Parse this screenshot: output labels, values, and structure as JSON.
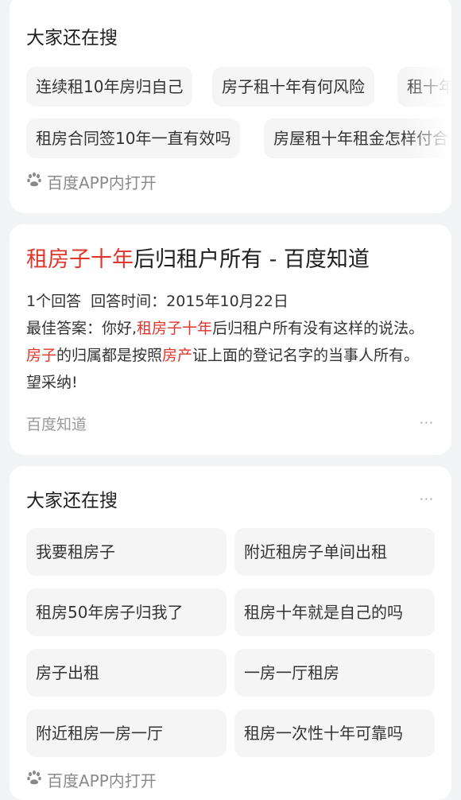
{
  "search_card_1": {
    "title": "大家还在搜",
    "chips_row1": [
      "连续租10年房归自己",
      "房子租十年有何风险",
      "租十年"
    ],
    "chips_row2": [
      "租房合同签10年一直有效吗",
      "房屋租十年租金怎样付合"
    ],
    "open_app": "百度APP内打开",
    "open_icon": "paw-icon"
  },
  "result": {
    "title_highlight": "租房子十年",
    "title_rest": "后归租户所有 - 百度知道",
    "meta": "1个回答  回答时间：2015年10月22日",
    "answer": [
      {
        "t": "最佳答案：你好,",
        "hl": false
      },
      {
        "t": "租房子十年",
        "hl": true
      },
      {
        "t": "后归租户所有没有这样的说法。",
        "hl": false
      },
      {
        "t": "房子",
        "hl": true
      },
      {
        "t": "的归属都是按照",
        "hl": false
      },
      {
        "t": "房产",
        "hl": true
      },
      {
        "t": "证上面的登记名字的当事人所有。 望采纳!",
        "hl": false
      }
    ],
    "source": "百度知道",
    "more": "···",
    "highlight_color": "#e0362c"
  },
  "search_card_2": {
    "title": "大家还在搜",
    "more": "···",
    "items": [
      "我要租房子",
      "附近租房子单间出租",
      "租房50年房子归我了",
      "租房十年就是自己的吗",
      "房子出租",
      "一房一厅租房",
      "附近租房一房一厅",
      "租房一次性十年可靠吗"
    ],
    "open_app": "百度APP内打开"
  }
}
